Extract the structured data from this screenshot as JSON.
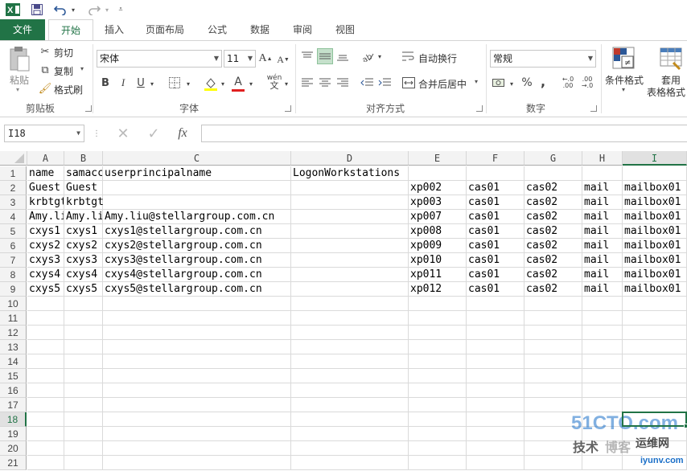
{
  "qat": {
    "app_icon": "excel-icon",
    "save_icon": "save-icon",
    "undo_icon": "undo-icon",
    "redo_icon": "redo-icon",
    "customize_icon": "customize-qat-icon"
  },
  "tabs": [
    {
      "label": "文件"
    },
    {
      "label": "开始"
    },
    {
      "label": "插入"
    },
    {
      "label": "页面布局"
    },
    {
      "label": "公式"
    },
    {
      "label": "数据"
    },
    {
      "label": "审阅"
    },
    {
      "label": "视图"
    }
  ],
  "ribbon": {
    "clipboard": {
      "paste": "粘贴",
      "cut": "剪切",
      "copy": "复制",
      "format_painter": "格式刷",
      "label": "剪贴板"
    },
    "font": {
      "font_name": "宋体",
      "font_size": "11",
      "bold": "B",
      "italic": "I",
      "underline": "U",
      "font_color_letter": "A",
      "phonetic": "wén",
      "label": "字体"
    },
    "alignment": {
      "wrap_text": "自动换行",
      "merge_center": "合并后居中",
      "label": "对齐方式"
    },
    "number": {
      "format": "常规",
      "percent": "%",
      "comma": ",",
      "label": "数字"
    },
    "styles": {
      "conditional_format": "条件格式",
      "table_format_line1": "套用",
      "table_format_line2": "表格格式"
    }
  },
  "formula_bar": {
    "name_box": "I18",
    "fx": "fx",
    "value": ""
  },
  "columns": [
    "A",
    "B",
    "C",
    "D",
    "E",
    "F",
    "G",
    "H",
    "I"
  ],
  "selected_column": "I",
  "selected_row": 18,
  "rows": [
    [
      "name",
      "samaccountname",
      "userprincipalname",
      "LogonWorkstations",
      "",
      "",
      "",
      "",
      ""
    ],
    [
      "Guest",
      "Guest",
      "",
      "",
      "xp002",
      "cas01",
      "cas02",
      "mail",
      "mailbox01"
    ],
    [
      "krbtgt",
      "krbtgt",
      "",
      "",
      "xp003",
      "cas01",
      "cas02",
      "mail",
      "mailbox01"
    ],
    [
      "Amy.liu",
      "Amy.liu",
      "Amy.liu@stellargroup.com.cn",
      "",
      "xp007",
      "cas01",
      "cas02",
      "mail",
      "mailbox01"
    ],
    [
      "cxys1",
      "cxys1",
      "cxys1@stellargroup.com.cn",
      "",
      "xp008",
      "cas01",
      "cas02",
      "mail",
      "mailbox01"
    ],
    [
      "cxys2",
      "cxys2",
      "cxys2@stellargroup.com.cn",
      "",
      "xp009",
      "cas01",
      "cas02",
      "mail",
      "mailbox01"
    ],
    [
      "cxys3",
      "cxys3",
      "cxys3@stellargroup.com.cn",
      "",
      "xp010",
      "cas01",
      "cas02",
      "mail",
      "mailbox01"
    ],
    [
      "cxys4",
      "cxys4",
      "cxys4@stellargroup.com.cn",
      "",
      "xp011",
      "cas01",
      "cas02",
      "mail",
      "mailbox01"
    ],
    [
      "cxys5",
      "cxys5",
      "cxys5@stellargroup.com.cn",
      "",
      "xp012",
      "cas01",
      "cas02",
      "mail",
      "mailbox01"
    ]
  ],
  "row_numbers": [
    "1",
    "2",
    "3",
    "4",
    "5",
    "6",
    "7",
    "8",
    "9",
    "10",
    "11",
    "12",
    "13",
    "14",
    "15",
    "16",
    "17",
    "18",
    "19",
    "20",
    "21"
  ],
  "watermark": {
    "line1": "51CTO.com",
    "line2a": "技术",
    "line2b": "博客",
    "line2c": "运维网",
    "line3": "iyunv.com"
  },
  "colors": {
    "excel_green": "#217346",
    "watermark_blue": "#1a6fc8"
  }
}
